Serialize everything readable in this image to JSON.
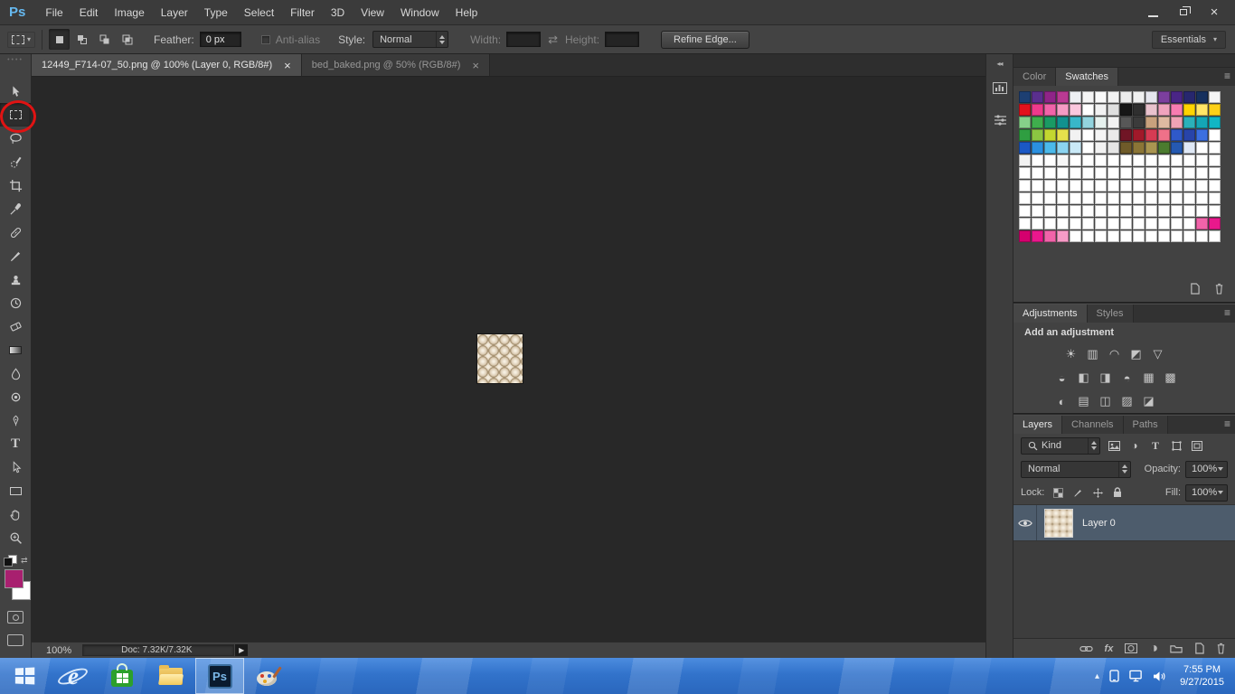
{
  "menu": {
    "logo": "Ps",
    "items": [
      "File",
      "Edit",
      "Image",
      "Layer",
      "Type",
      "Select",
      "Filter",
      "3D",
      "View",
      "Window",
      "Help"
    ]
  },
  "options": {
    "feather_label": "Feather:",
    "feather_value": "0 px",
    "antialias_label": "Anti-alias",
    "style_label": "Style:",
    "style_value": "Normal",
    "width_label": "Width:",
    "width_value": "",
    "height_label": "Height:",
    "height_value": "",
    "refine_edge_label": "Refine Edge...",
    "workspace": "Essentials"
  },
  "doc_tabs": [
    {
      "title": "12449_F714-07_50.png @ 100% (Layer 0, RGB/8#)",
      "close_glyph": "×",
      "active": true
    },
    {
      "title": "bed_baked.png @ 50% (RGB/8#)",
      "close_glyph": "×",
      "active": false
    }
  ],
  "tools": {
    "items": [
      "move-tool",
      "rectangular-marquee-tool",
      "lasso-tool",
      "quick-selection-tool",
      "crop-tool",
      "eyedropper-tool",
      "spot-healing-brush-tool",
      "brush-tool",
      "clone-stamp-tool",
      "history-brush-tool",
      "eraser-tool",
      "gradient-tool",
      "blur-tool",
      "dodge-tool",
      "pen-tool",
      "type-tool",
      "path-selection-tool",
      "rectangle-tool",
      "hand-tool",
      "zoom-tool"
    ],
    "active": "rectangular-marquee-tool",
    "foreground_color": "#a8206f",
    "background_color": "#ffffff"
  },
  "status": {
    "zoom": "100%",
    "doc_info": "Doc: 7.32K/7.32K"
  },
  "swatches_panel": {
    "tabs": [
      "Color",
      "Swatches"
    ],
    "active_tab": "Swatches",
    "grid": [
      [
        "#1d3f72",
        "#5a2f8e",
        "#8f2488",
        "#b93a93",
        "#eef0f3",
        "#f5f5f5",
        "#fafafa",
        "#f2f2f2",
        "#ececec",
        "#f0f0f0",
        "#e6e6ee",
        "#7c3f9e",
        "#4a2586",
        "#27276e",
        "#16305e",
        "#f5f5f5"
      ],
      [
        "#e3111c",
        "#ee3a8c",
        "#f163a9",
        "#f59bc4",
        "#fac7dd",
        "#ffffff",
        "#f2f2f2",
        "#dfdfdf",
        "#161616",
        "#2f2f2f",
        "#e9c2cd",
        "#f0a3be",
        "#f77cb1",
        "#ffd400",
        "#ffe566",
        "#fdd017"
      ],
      [
        "#86d08a",
        "#3fae4d",
        "#1a9a64",
        "#12918f",
        "#39b7c9",
        "#93d4de",
        "#e6f1ee",
        "#f2f2f2",
        "#575757",
        "#3b3b3b",
        "#c8a17d",
        "#dfb9a1",
        "#eea3b5",
        "#2bb1ba",
        "#14a6b5",
        "#12b6c4"
      ],
      [
        "#2f9e41",
        "#8bc642",
        "#c3d730",
        "#e6e14c",
        "#f2f2f2",
        "#ffffff",
        "#f5f5f5",
        "#eaeaea",
        "#701525",
        "#a1192a",
        "#d63b53",
        "#ef7189",
        "#2f59c9",
        "#2844a9",
        "#3b6fe0",
        "#ffffff"
      ],
      [
        "#1b58c5",
        "#2b90e0",
        "#4bb9ea",
        "#8bd3f0",
        "#c9e9f7",
        "#ffffff",
        "#f2f2f2",
        "#e5e5e5",
        "#6f5b29",
        "#8b7536",
        "#a99551",
        "#4b7b2f",
        "#2559b1",
        "#e0e9f6",
        "#ffffff",
        "#ffffff"
      ],
      [
        "#f2f2f2",
        "#ffffff",
        "#ffffff",
        "#f7f7f7",
        "#ffffff",
        "#ffffff",
        "#ffffff",
        "#ffffff",
        "#ffffff",
        "#ffffff",
        "#ffffff",
        "#ffffff",
        "#ffffff",
        "#ffffff",
        "#ffffff",
        "#ffffff"
      ],
      [
        "#ffffff",
        "#ffffff",
        "#ffffff",
        "#ffffff",
        "#ffffff",
        "#ffffff",
        "#ffffff",
        "#ffffff",
        "#ffffff",
        "#ffffff",
        "#ffffff",
        "#ffffff",
        "#ffffff",
        "#ffffff",
        "#ffffff",
        "#ffffff"
      ],
      [
        "#ffffff",
        "#ffffff",
        "#ffffff",
        "#ffffff",
        "#ffffff",
        "#ffffff",
        "#ffffff",
        "#ffffff",
        "#ffffff",
        "#ffffff",
        "#ffffff",
        "#ffffff",
        "#ffffff",
        "#ffffff",
        "#ffffff",
        "#ffffff"
      ],
      [
        "#ffffff",
        "#ffffff",
        "#ffffff",
        "#ffffff",
        "#ffffff",
        "#ffffff",
        "#ffffff",
        "#ffffff",
        "#ffffff",
        "#ffffff",
        "#ffffff",
        "#ffffff",
        "#ffffff",
        "#ffffff",
        "#ffffff",
        "#ffffff"
      ],
      [
        "#ffffff",
        "#ffffff",
        "#ffffff",
        "#ffffff",
        "#ffffff",
        "#ffffff",
        "#ffffff",
        "#ffffff",
        "#ffffff",
        "#ffffff",
        "#ffffff",
        "#ffffff",
        "#ffffff",
        "#ffffff",
        "#ffffff",
        "#ffffff"
      ],
      [
        "#ffffff",
        "#ffffff",
        "#ffffff",
        "#ffffff",
        "#ffffff",
        "#ffffff",
        "#ffffff",
        "#ffffff",
        "#ffffff",
        "#ffffff",
        "#ffffff",
        "#ffffff",
        "#ffffff",
        "#ffffff",
        "#f163a9",
        "#e9188c"
      ],
      [
        "#d4006e",
        "#e9188c",
        "#f163a9",
        "#f79bc7",
        "#ffffff",
        "#ffffff",
        "#ffffff",
        "#ffffff",
        "#ffffff",
        "#ffffff",
        "#ffffff",
        "#ffffff",
        "#ffffff",
        "#ffffff",
        "#ffffff",
        "#ffffff"
      ]
    ]
  },
  "adjustments_panel": {
    "tabs": [
      "Adjustments",
      "Styles"
    ],
    "active_tab": "Adjustments",
    "heading": "Add an adjustment",
    "icon_rows": [
      [
        "brightness-contrast",
        "levels",
        "curves",
        "exposure",
        "vibrance"
      ],
      [
        "hue-saturation",
        "color-balance",
        "black-white",
        "photo-filter",
        "channel-mixer",
        "color-lookup"
      ],
      [
        "invert",
        "posterize",
        "threshold",
        "selective-color",
        "gradient-map"
      ]
    ]
  },
  "layers_panel": {
    "tabs": [
      "Layers",
      "Channels",
      "Paths"
    ],
    "active_tab": "Layers",
    "kind_filter": "Kind",
    "blend_mode": "Normal",
    "opacity_label": "Opacity:",
    "opacity_value": "100%",
    "lock_label": "Lock:",
    "fill_label": "Fill:",
    "fill_value": "100%",
    "fx_label": "fx",
    "layers": [
      {
        "name": "Layer 0",
        "selected": true
      }
    ]
  },
  "taskbar": {
    "apps": [
      {
        "name": "start-button"
      },
      {
        "name": "internet-explorer"
      },
      {
        "name": "windows-store"
      },
      {
        "name": "file-explorer"
      },
      {
        "name": "photoshop",
        "active": true
      },
      {
        "name": "paint"
      }
    ],
    "time": "7:55 PM",
    "date": "9/27/2015"
  }
}
